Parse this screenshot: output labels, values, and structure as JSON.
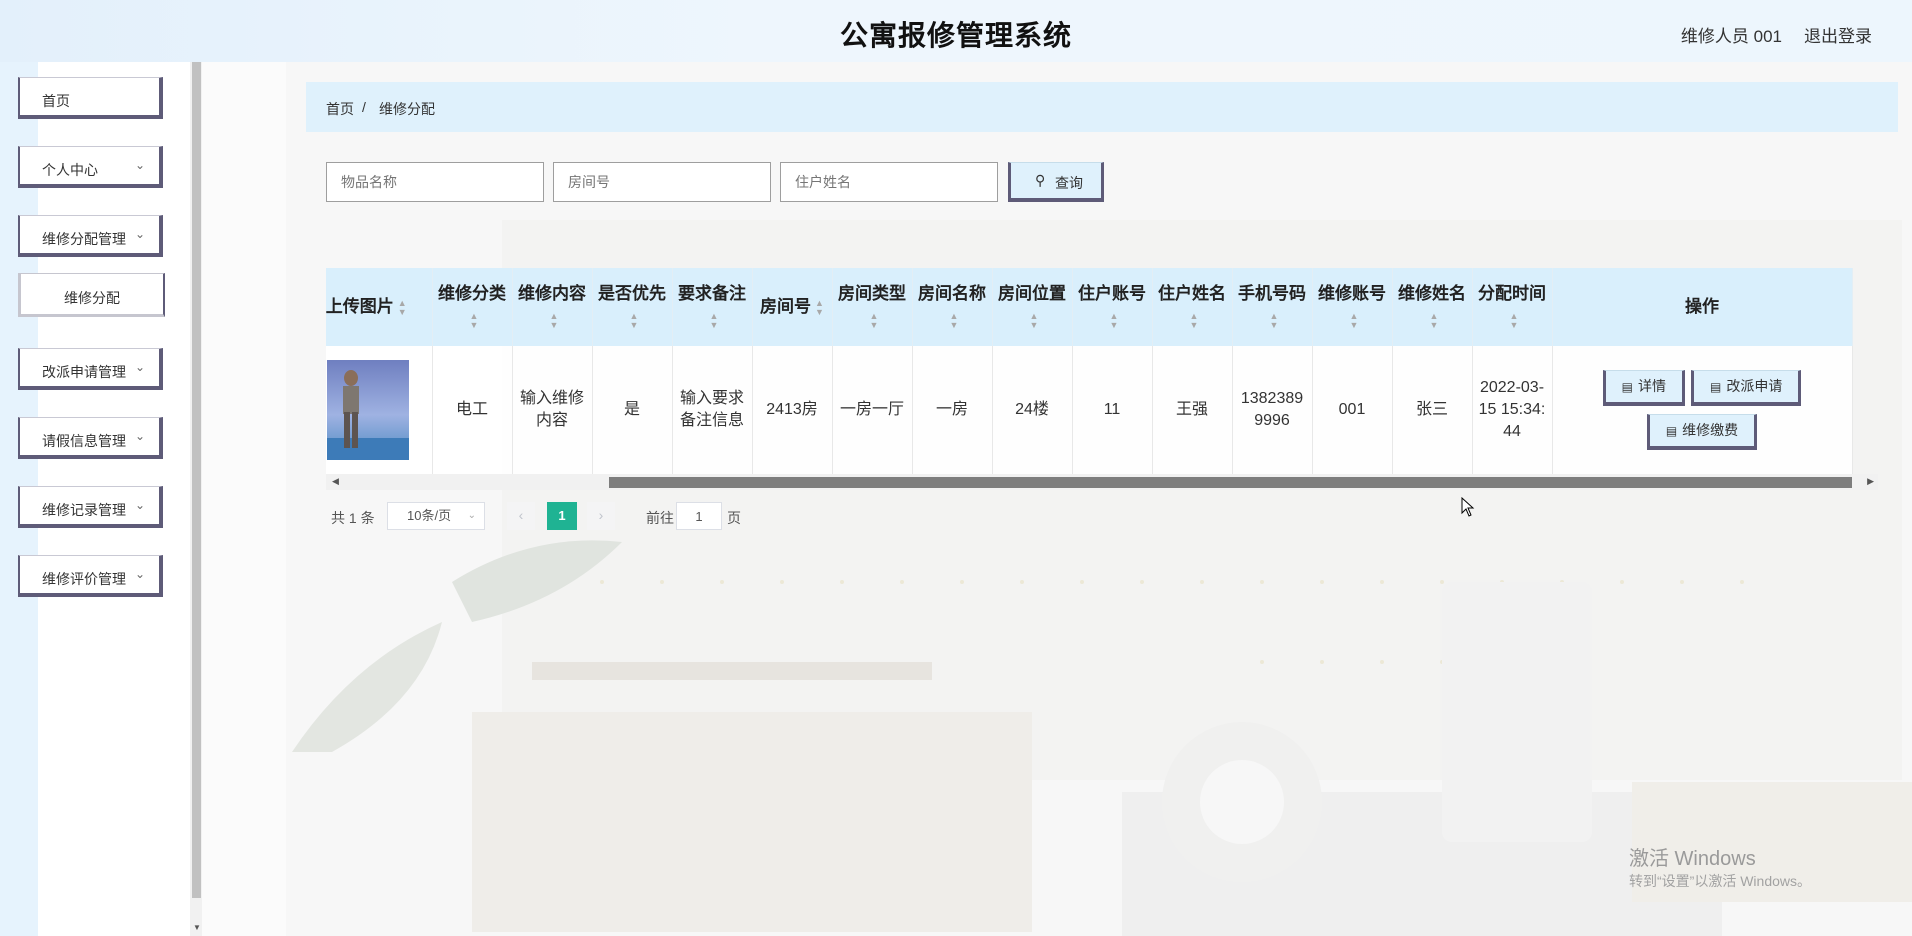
{
  "header": {
    "title": "公寓报修管理系统",
    "user": "维修人员 001",
    "logout": "退出登录"
  },
  "sidebar": {
    "items": [
      {
        "label": "首页",
        "expandable": false
      },
      {
        "label": "个人中心",
        "expandable": true
      },
      {
        "label": "维修分配管理",
        "expandable": true
      },
      {
        "label": "维修分配",
        "expandable": false,
        "sub": true
      },
      {
        "label": "改派申请管理",
        "expandable": true
      },
      {
        "label": "请假信息管理",
        "expandable": true
      },
      {
        "label": "维修记录管理",
        "expandable": true
      },
      {
        "label": "维修评价管理",
        "expandable": true
      }
    ]
  },
  "breadcrumb": {
    "home": "首页",
    "separator": "/",
    "current": "维修分配"
  },
  "search": {
    "item_placeholder": "物品名称",
    "room_placeholder": "房间号",
    "resident_placeholder": "住户姓名",
    "button": "查询"
  },
  "table": {
    "headers": [
      "上传图片",
      "维修分类",
      "维修内容",
      "是否优先",
      "要求备注",
      "房间号",
      "房间类型",
      "房间名称",
      "房间位置",
      "住户账号",
      "住户姓名",
      "手机号码",
      "维修账号",
      "维修姓名",
      "分配时间",
      "操作"
    ],
    "rows": [
      {
        "image": "photo",
        "category": "电工",
        "content": "输入维修内容",
        "priority": "是",
        "remark": "输入要求备注信息",
        "room_no": "2413房",
        "room_type": "一房一厅",
        "room_name": "一房",
        "room_location": "24楼",
        "resident_account": "11",
        "resident_name": "王强",
        "phone": "13823899996",
        "repair_account": "001",
        "repair_name": "张三",
        "assign_time": "2022-03-15 15:34:44"
      }
    ],
    "actions": {
      "detail": "详情",
      "reassign": "改派申请",
      "pay": "维修缴费"
    }
  },
  "pagination": {
    "total": "共 1 条",
    "page_size": "10条/页",
    "current": "1",
    "goto_prefix": "前往",
    "goto_value": "1",
    "goto_suffix": "页",
    "accent": "#1fb393"
  },
  "watermark": {
    "line1": "激活 Windows",
    "line2": "转到“设置”以激活 Windows。"
  }
}
